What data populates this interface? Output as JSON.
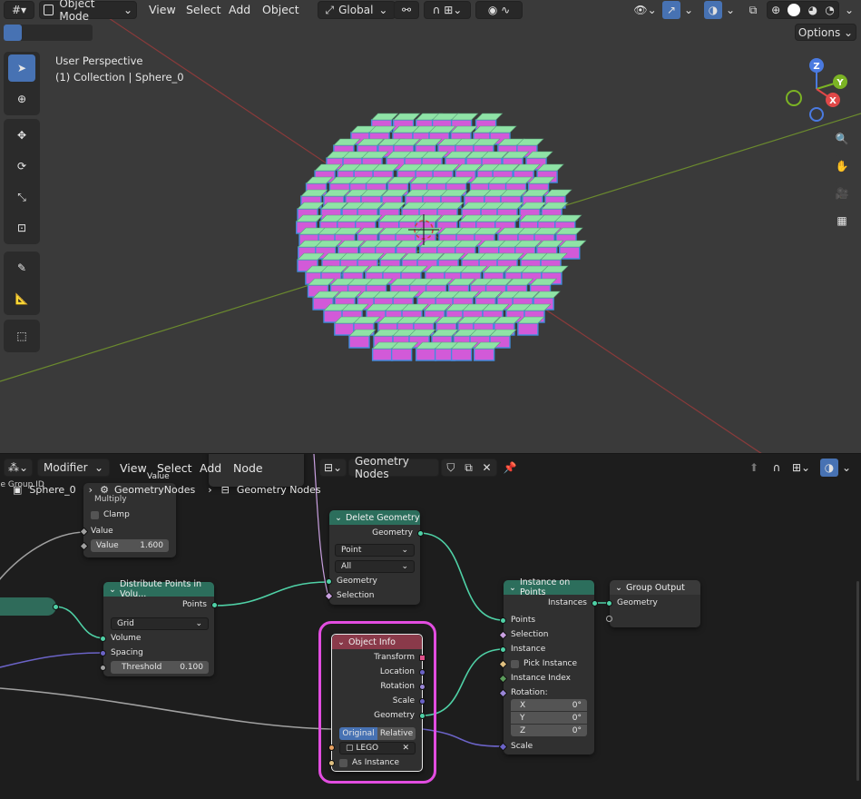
{
  "viewport": {
    "mode": "Object Mode",
    "menus": [
      "View",
      "Select",
      "Add",
      "Object"
    ],
    "transform": "Global",
    "options": "Options",
    "info_line1": "User Perspective",
    "info_line2": "(1) Collection | Sphere_0",
    "gizmo": {
      "z": "Z",
      "y": "Y",
      "x": "X"
    },
    "colors": {
      "top": "#8fe3a6",
      "side": "#d25ad8",
      "edge": "#3f8dde",
      "bg": "#3a3a3a"
    }
  },
  "node_editor": {
    "editor_type": "Modifier",
    "menus": [
      "View",
      "Select",
      "Add",
      "Node"
    ],
    "tree_name": "Geometry Nodes",
    "breadcrumb": {
      "object": "Sphere_0",
      "modifier": "GeometryNodes",
      "tree": "Geometry Nodes"
    },
    "partial_labels": {
      "value_top": "Value",
      "group_id": "le Group ID",
      "multiply": "Multiply"
    },
    "math_node": {
      "clamp": "Clamp",
      "value_label": "Value",
      "value_field": "Value",
      "value": "1.600"
    },
    "delete_geometry": {
      "title": "Delete Geometry",
      "out_geometry": "Geometry",
      "domain": "Point",
      "mode": "All",
      "in_geometry": "Geometry",
      "selection": "Selection"
    },
    "distribute": {
      "title": "Distribute Points in Volu...",
      "points": "Points",
      "mode": "Grid",
      "volume": "Volume",
      "spacing": "Spacing",
      "threshold_label": "Threshold",
      "threshold": "0.100"
    },
    "object_info": {
      "title": "Object Info",
      "transform": "Transform",
      "location": "Location",
      "rotation": "Rotation",
      "scale": "Scale",
      "geometry": "Geometry",
      "original": "Original",
      "relative": "Relative",
      "object": "LEGO",
      "as_instance": "As Instance"
    },
    "instance_on_points": {
      "title": "Instance on Points",
      "instances": "Instances",
      "points": "Points",
      "selection": "Selection",
      "instance": "Instance",
      "pick_instance": "Pick Instance",
      "instance_index": "Instance Index",
      "rotation": "Rotation:",
      "x": "X",
      "y": "Y",
      "z": "Z",
      "rx": "0°",
      "ry": "0°",
      "rz": "0°",
      "scale": "Scale"
    },
    "group_output": {
      "title": "Group Output",
      "geometry": "Geometry"
    }
  }
}
